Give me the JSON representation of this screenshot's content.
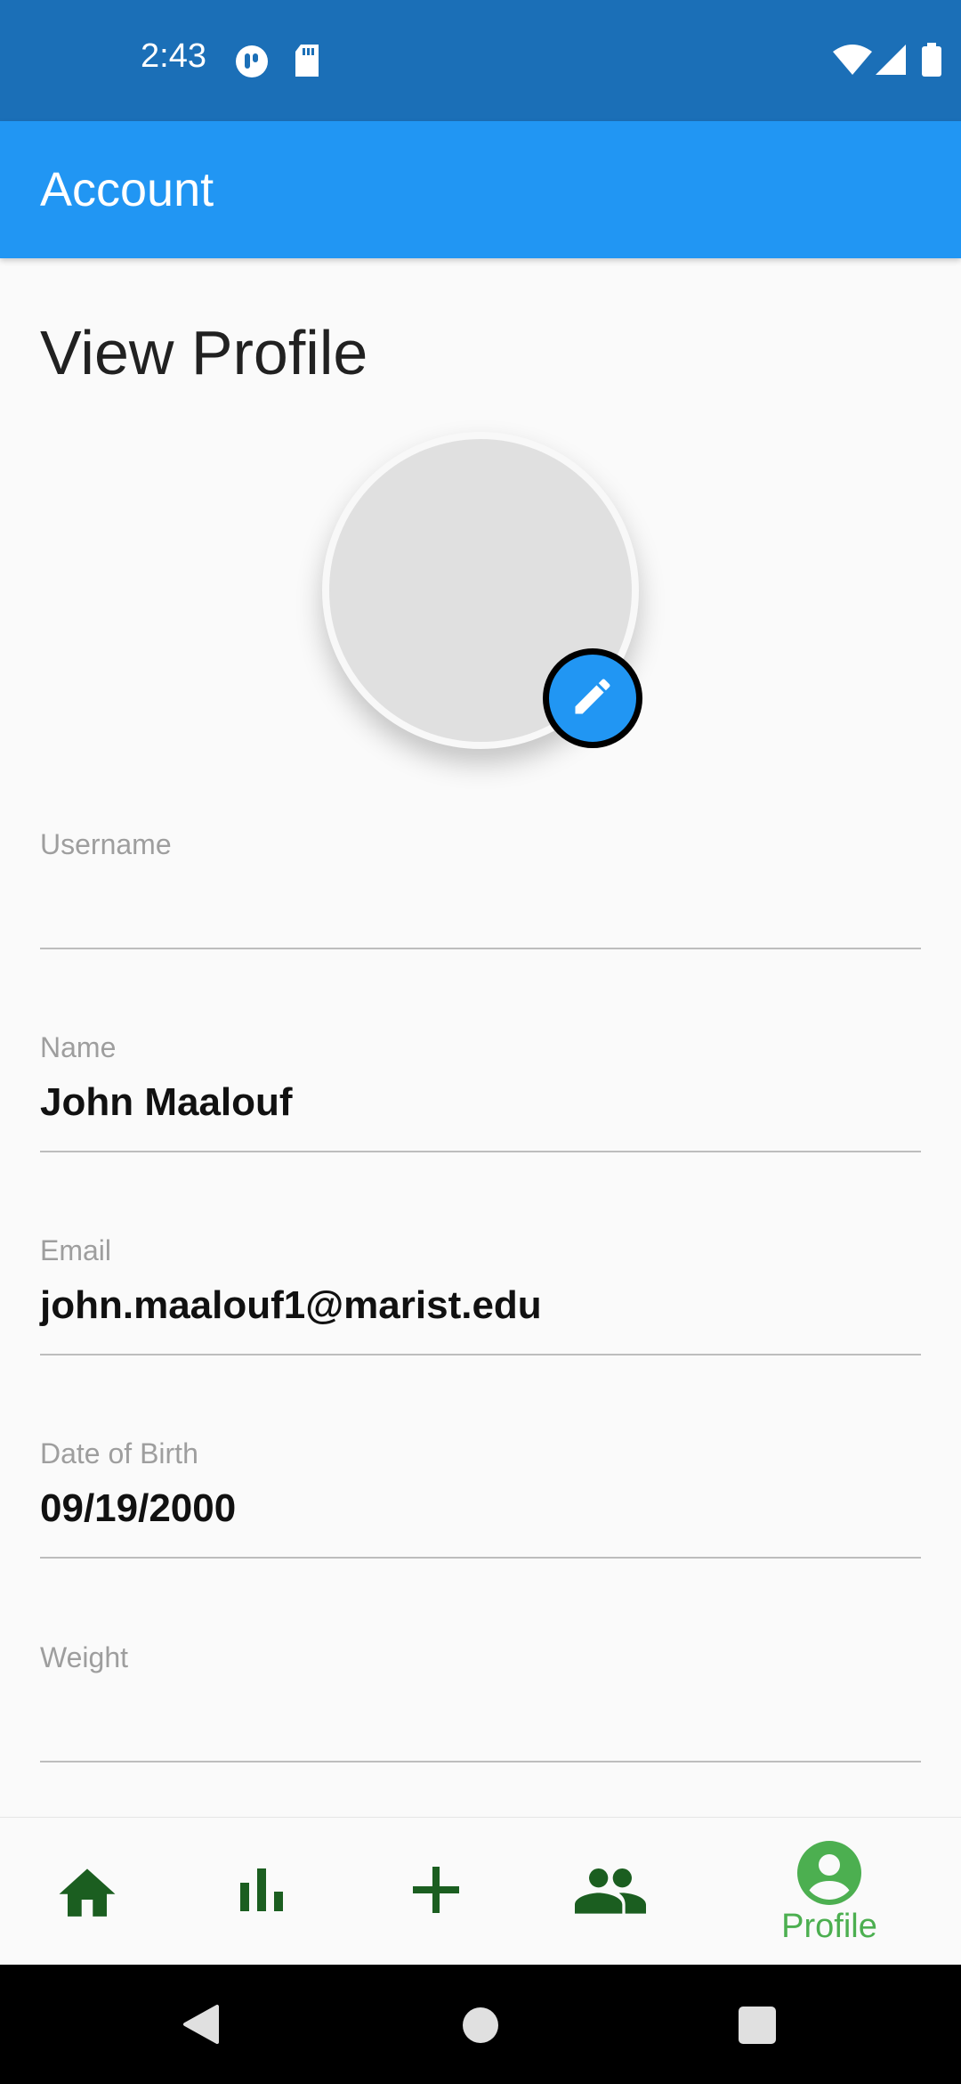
{
  "status_bar": {
    "time": "2:43"
  },
  "app_bar": {
    "title": "Account"
  },
  "page": {
    "title": "View Profile"
  },
  "fields": {
    "username": {
      "label": "Username",
      "value": ""
    },
    "name": {
      "label": "Name",
      "value": "John Maalouf"
    },
    "email": {
      "label": "Email",
      "value": "john.maalouf1@marist.edu"
    },
    "dob": {
      "label": "Date of Birth",
      "value": "09/19/2000"
    },
    "weight": {
      "label": "Weight",
      "value": ""
    }
  },
  "bottom_nav": {
    "items": [
      {
        "icon": "home-icon"
      },
      {
        "icon": "bar-chart-icon"
      },
      {
        "icon": "add-icon"
      },
      {
        "icon": "people-icon"
      },
      {
        "icon": "account-circle-icon",
        "label": "Profile",
        "selected": true
      }
    ]
  },
  "colors": {
    "status_bar": "#1b6fb7",
    "app_bar": "#2196f3",
    "nav_icon": "#1b5e20",
    "nav_selected": "#4caf50"
  }
}
